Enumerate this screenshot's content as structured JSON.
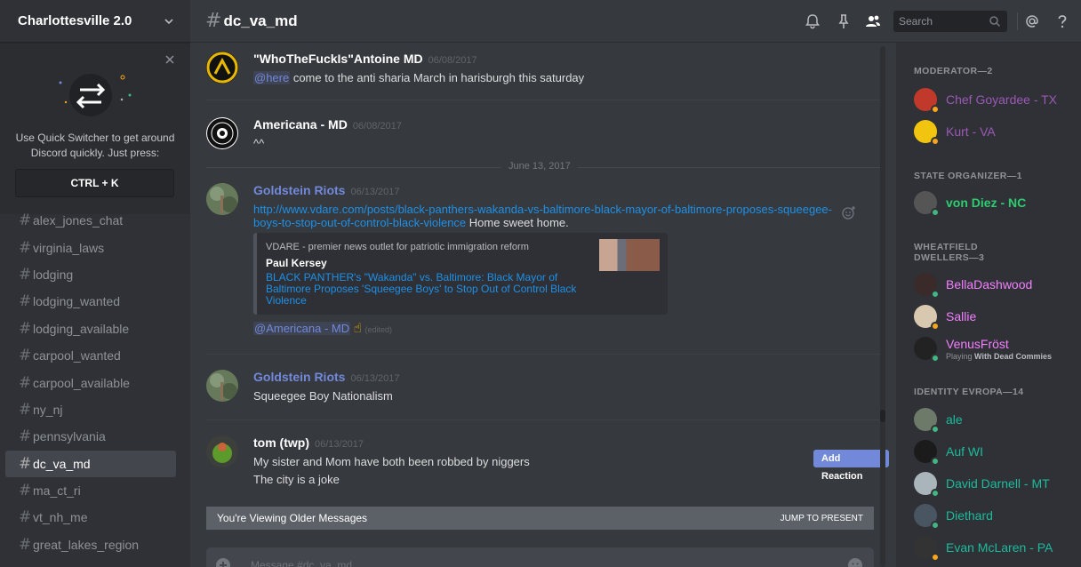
{
  "sidebar": {
    "guild_name": "Charlottesville 2.0",
    "quick_switcher": {
      "text": "Use Quick Switcher to get around Discord quickly. Just press:",
      "shortcut": "CTRL + K"
    },
    "channels": [
      "alex_jones_chat",
      "virginia_laws",
      "lodging",
      "lodging_wanted",
      "lodging_available",
      "carpool_wanted",
      "carpool_available",
      "ny_nj",
      "pennsylvania",
      "dc_va_md",
      "ma_ct_ri",
      "vt_nh_me",
      "great_lakes_region"
    ],
    "active_channel": "dc_va_md"
  },
  "topbar": {
    "hash": "#",
    "channel": "dc_va_md",
    "search_placeholder": "Search"
  },
  "messages": [
    {
      "author": "\"WhoTheFuckIs\"Antoine MD",
      "timestamp": "06/08/2017",
      "mention": "@here",
      "text": " come to the anti sharia March in harisburgh this saturday"
    },
    {
      "author": "Americana - MD",
      "timestamp": "06/08/2017",
      "text": "^^"
    },
    {
      "author": "Goldstein Riots",
      "timestamp": "06/13/2017",
      "link": "http://www.vdare.com/posts/black-panthers-wakanda-vs-baltimore-black-mayor-of-baltimore-proposes-squeegee-boys-to-stop-out-of-control-black-violence",
      "text": " Home sweet home.",
      "mention": "@Americana - MD",
      "edited": "(edited)"
    },
    {
      "author": "Goldstein Riots",
      "timestamp": "06/13/2017",
      "text": "Squeegee Boy Nationalism"
    },
    {
      "author": "tom (twp)",
      "timestamp": "06/13/2017",
      "lines": [
        "My sister and Mom have both been robbed by niggers",
        "The city is a joke"
      ]
    }
  ],
  "date_divider": "June 13, 2017",
  "embed": {
    "provider": "VDARE - premier news outlet for patriotic immigration reform",
    "author": "Paul Kersey",
    "title": "BLACK PANTHER's \"Wakanda\" vs. Baltimore: Black Mayor of Baltimore Proposes 'Squeegee Boys' to Stop Out of Control Black Violence"
  },
  "add_reaction": "Add Reaction",
  "older_bar": {
    "text": "You're Viewing Older Messages",
    "jump": "JUMP TO PRESENT"
  },
  "composer": {
    "placeholder": "Message #dc_va_md"
  },
  "members": {
    "roles": [
      {
        "name": "MODERATOR—2",
        "members": [
          {
            "name": "Chef Goyardee - TX",
            "color": "#9b59b6",
            "status": "#faa61a"
          },
          {
            "name": "Kurt - VA",
            "color": "#9b59b6",
            "status": "#faa61a"
          }
        ]
      },
      {
        "name": "STATE ORGANIZER—1",
        "members": [
          {
            "name": "von Diez - NC",
            "color": "#2ecc71",
            "status": "#43b581"
          }
        ]
      },
      {
        "name": "WHEATFIELD DWELLERS—3",
        "members": [
          {
            "name": "BellaDashwood",
            "color": "#f47fff",
            "status": "#43b581"
          },
          {
            "name": "Sallie",
            "color": "#f47fff",
            "status": "#faa61a"
          },
          {
            "name": "VenusFröst",
            "color": "#f47fff",
            "status": "#43b581",
            "playing": "Playing ",
            "game": "With Dead Commies"
          }
        ]
      },
      {
        "name": "IDENTITY EVROPA—14",
        "members": [
          {
            "name": "ale",
            "color": "#1abc9c",
            "status": "#43b581"
          },
          {
            "name": "Auf WI",
            "color": "#1abc9c",
            "status": "#43b581"
          },
          {
            "name": "David Darnell - MT",
            "color": "#1abc9c",
            "status": "#43b581"
          },
          {
            "name": "Diethard",
            "color": "#1abc9c",
            "status": "#43b581"
          },
          {
            "name": "Evan McLaren - PA",
            "color": "#1abc9c",
            "status": "#faa61a"
          }
        ]
      }
    ]
  }
}
